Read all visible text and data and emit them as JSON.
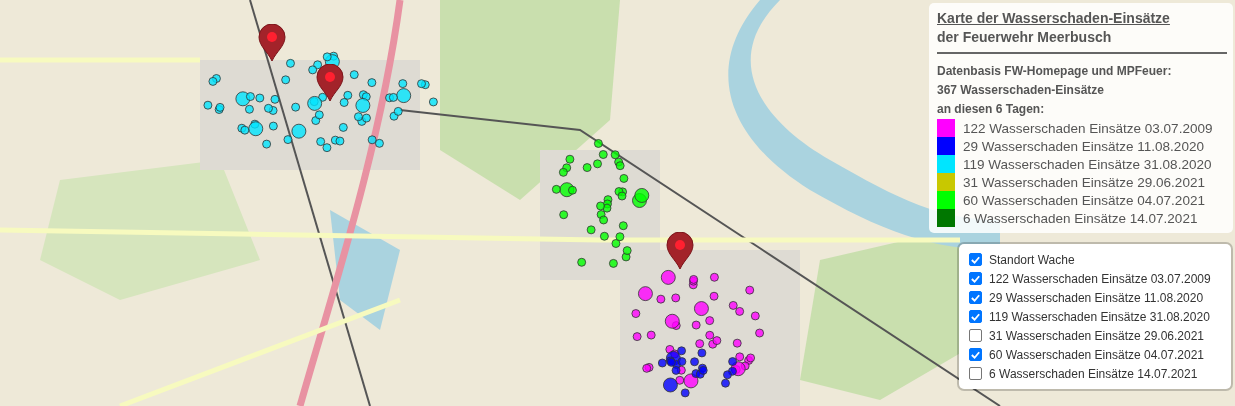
{
  "legend": {
    "title_lines": [
      "Karte der Wasserschaden-Einsätze",
      "der Feuerwehr Meerbusch"
    ],
    "info_lines": [
      "Datenbasis FW-Homepage und MPFeuer:",
      "367 Wasserschaden-Einsätze",
      "an diesen 6 Tagen:"
    ],
    "items": [
      {
        "label": "122 Wasserschaden Einsätze 03.07.2009",
        "color": "#ff00ff"
      },
      {
        "label": "29 Wasserschaden Einsätze 11.08.2020",
        "color": "#0000ff"
      },
      {
        "label": "119 Wasserschaden Einsätze 31.08.2020",
        "color": "#00e5ff"
      },
      {
        "label": "31 Wasserschaden Einsätze 29.06.2021",
        "color": "#c8c800"
      },
      {
        "label": "60 Wasserschaden Einsätze 04.07.2021",
        "color": "#00ff00"
      },
      {
        "label": "6 Wasserschaden Einsätze 14.07.2021",
        "color": "#007700"
      }
    ]
  },
  "layer_control": {
    "layers": [
      {
        "label": "Standort Wache",
        "checked": true
      },
      {
        "label": "122 Wasserschaden Einsätze 03.07.2009",
        "checked": true
      },
      {
        "label": "29 Wasserschaden Einsätze 11.08.2020",
        "checked": true
      },
      {
        "label": "119 Wasserschaden Einsätze 31.08.2020",
        "checked": true
      },
      {
        "label": "31 Wasserschaden Einsätze 29.06.2021",
        "checked": false
      },
      {
        "label": "60 Wasserschaden Einsätze 04.07.2021",
        "checked": true
      },
      {
        "label": "6 Wasserschaden Einsätze 14.07.2021",
        "checked": false
      }
    ]
  }
}
